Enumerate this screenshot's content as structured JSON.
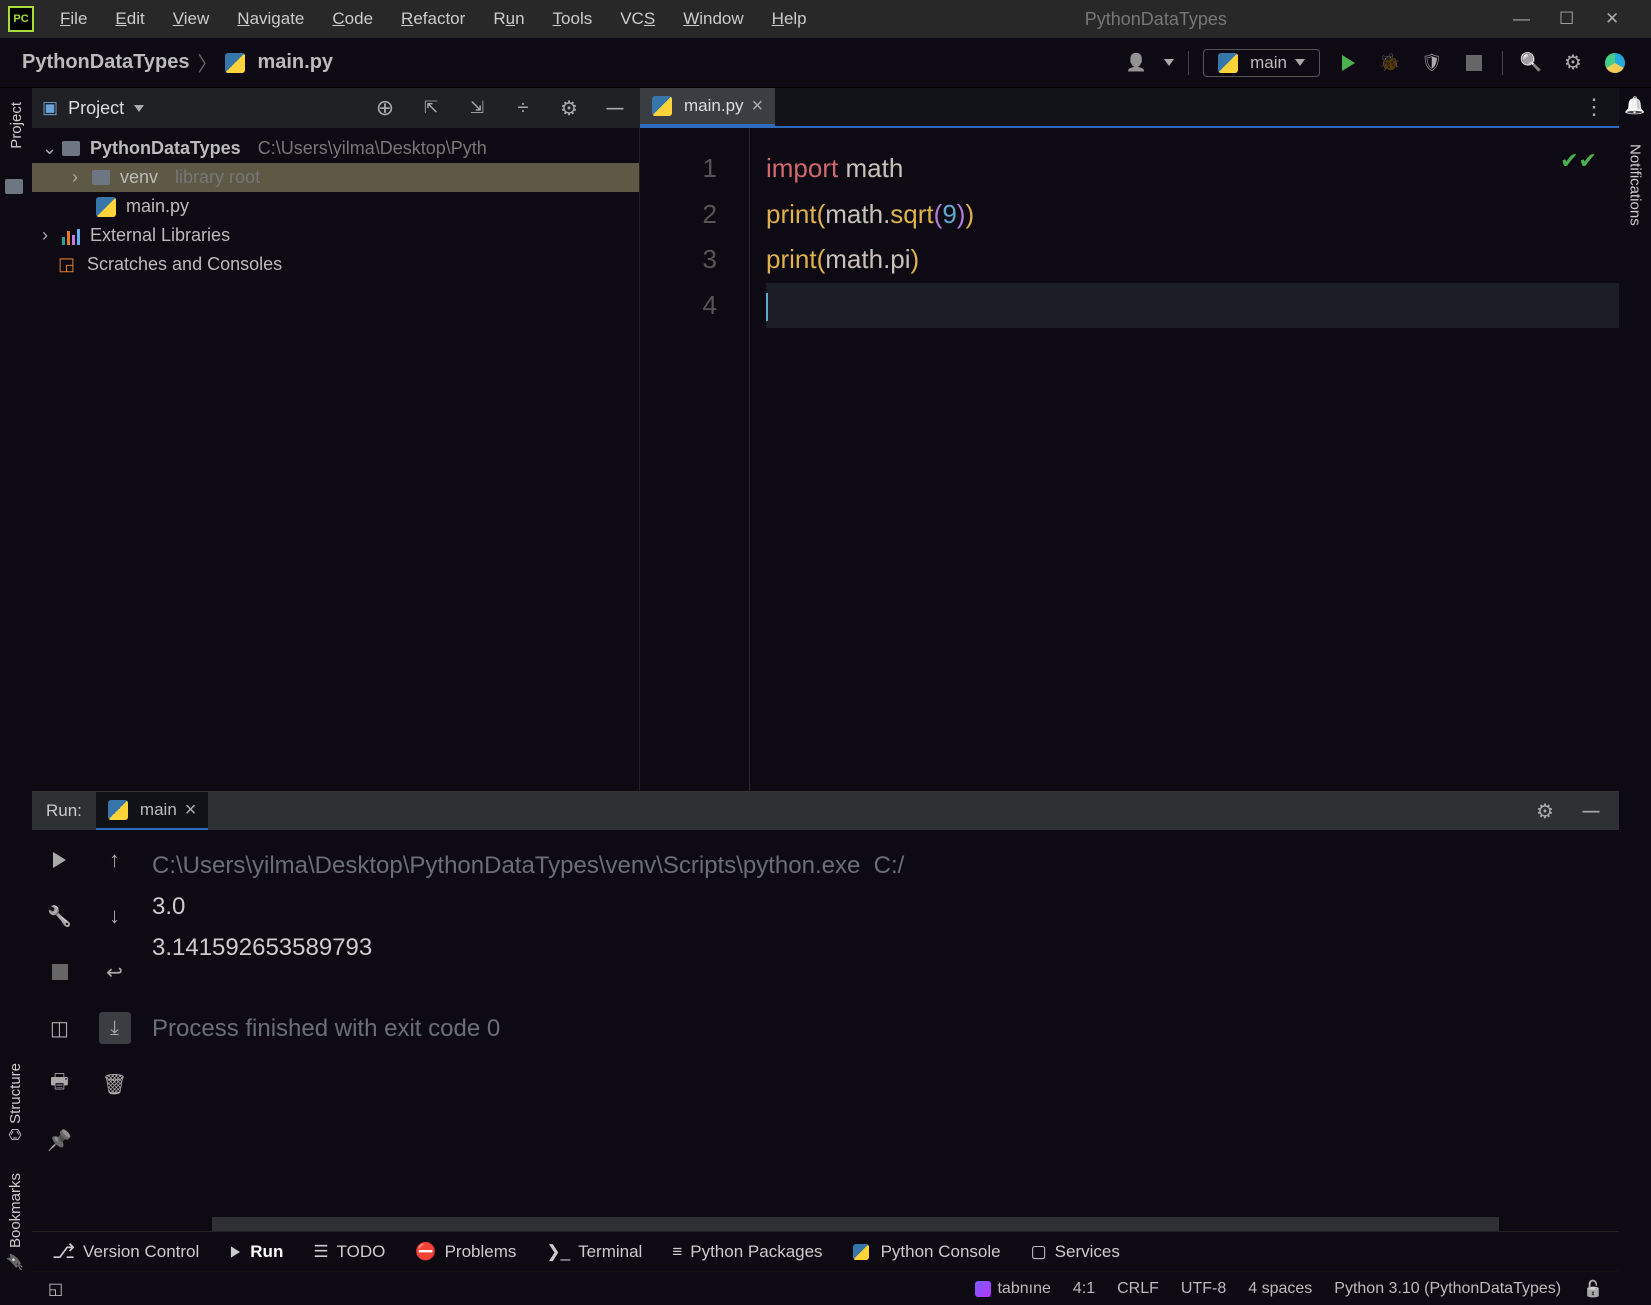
{
  "window": {
    "title": "PythonDataTypes"
  },
  "menu": {
    "file": "File",
    "edit": "Edit",
    "view": "View",
    "navigate": "Navigate",
    "code": "Code",
    "refactor": "Refactor",
    "run": "Run",
    "tools": "Tools",
    "vcs": "VCS",
    "window": "Window",
    "help": "Help"
  },
  "breadcrumb": {
    "project": "PythonDataTypes",
    "file": "main.py"
  },
  "runConfig": {
    "name": "main"
  },
  "leftStrip": {
    "project": "Project",
    "structure": "Structure",
    "bookmarks": "Bookmarks"
  },
  "rightStrip": {
    "notifications": "Notifications"
  },
  "projectPane": {
    "title": "Project",
    "root": {
      "name": "PythonDataTypes",
      "path": "C:\\Users\\yilma\\Desktop\\Pyth"
    },
    "venv": {
      "name": "venv",
      "hint": "library root"
    },
    "mainfile": "main.py",
    "ext": "External Libraries",
    "scratch": "Scratches and Consoles"
  },
  "editor": {
    "tabName": "main.py",
    "gutters": [
      "1",
      "2",
      "3",
      "4"
    ],
    "code": {
      "l1": {
        "kw": "import",
        "sp": " ",
        "id": "math"
      },
      "l2": {
        "fn": "print",
        "p1": "(",
        "id1": "math",
        "dot1": ".",
        "m": "sqrt",
        "p2": "(",
        "n": "9",
        "p3": ")",
        ")": ")"
      },
      "l3": {
        "fn": "print",
        "p1": "(",
        "id1": "math",
        "dot1": ".",
        "m": "pi",
        "p2": ")"
      }
    }
  },
  "run": {
    "title": "Run:",
    "tab": "main",
    "cmd": "C:\\Users\\yilma\\Desktop\\PythonDataTypes\\venv\\Scripts\\python.exe  C:/",
    "out1": "3.0",
    "out2": "3.141592653589793",
    "exit": "Process finished with exit code 0"
  },
  "bottom": {
    "vcs": "Version Control",
    "run": "Run",
    "todo": "TODO",
    "problems": "Problems",
    "terminal": "Terminal",
    "pkgs": "Python Packages",
    "console": "Python Console",
    "services": "Services"
  },
  "status": {
    "tabnine": "tabnıne",
    "pos": "4:1",
    "eol": "CRLF",
    "enc": "UTF-8",
    "indent": "4 spaces",
    "interp": "Python 3.10 (PythonDataTypes)"
  }
}
